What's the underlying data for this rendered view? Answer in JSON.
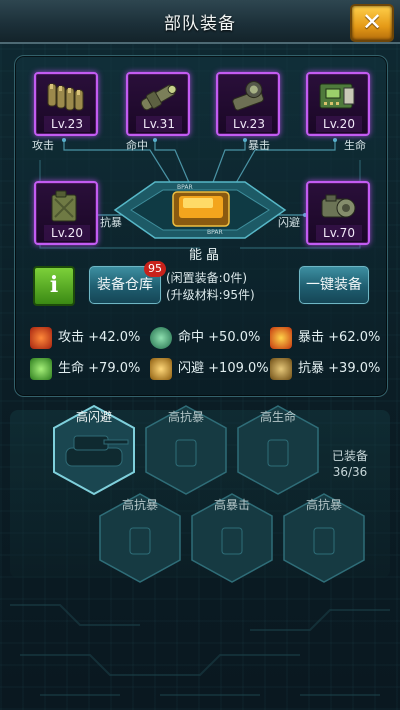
{
  "header": {
    "title": "部队装备",
    "close_label": "✕"
  },
  "slots": [
    {
      "label": "攻击",
      "level": "Lv.23",
      "icon": "ammo-belt-icon"
    },
    {
      "label": "命中",
      "level": "Lv.31",
      "icon": "scope-icon"
    },
    {
      "label": "暴击",
      "level": "Lv.23",
      "icon": "gun-sight-icon"
    },
    {
      "label": "生命",
      "level": "Lv.20",
      "icon": "circuit-board-icon"
    },
    {
      "label": "抗暴",
      "level": "Lv.20",
      "icon": "jerrycan-icon"
    },
    {
      "label": "闪避",
      "level": "Lv.70",
      "icon": "engine-icon"
    }
  ],
  "crystal": {
    "label": "能晶",
    "plate_text_top": "BPAR",
    "plate_text_bottom": "BPAR"
  },
  "actions": {
    "info_label": "i",
    "warehouse_label": "装备仓库",
    "warehouse_badge": "95",
    "idle_equipment": "(闲置装备:0件)",
    "upgrade_material": "(升级材料:95件)",
    "one_click_label": "一键装备"
  },
  "stats": [
    {
      "name": "攻击",
      "value": "+42.0%",
      "icon": "attack-icon",
      "color": "#e0432a"
    },
    {
      "name": "命中",
      "value": "+50.0%",
      "icon": "hit-icon",
      "color": "#3aa37a"
    },
    {
      "name": "暴击",
      "value": "+62.0%",
      "icon": "crit-icon",
      "color": "#f07020"
    },
    {
      "name": "生命",
      "value": "+79.0%",
      "icon": "heart-icon",
      "color": "#4bbf36"
    },
    {
      "name": "闪避",
      "value": "+109.0%",
      "icon": "dodge-icon",
      "color": "#e0a32a"
    },
    {
      "name": "抗暴",
      "value": "+39.0%",
      "icon": "resist-icon",
      "color": "#d98a26"
    }
  ],
  "slots_row1": [
    {
      "label": "高闪避",
      "state": "active"
    },
    {
      "label": "高抗暴",
      "state": "locked"
    },
    {
      "label": "高生命",
      "state": "locked"
    }
  ],
  "slots_row2": [
    {
      "label": "高抗暴",
      "state": "locked"
    },
    {
      "label": "高暴击",
      "state": "locked"
    },
    {
      "label": "高抗暴",
      "state": "locked"
    }
  ],
  "equipped": {
    "label": "已装备",
    "count": "36/36"
  }
}
